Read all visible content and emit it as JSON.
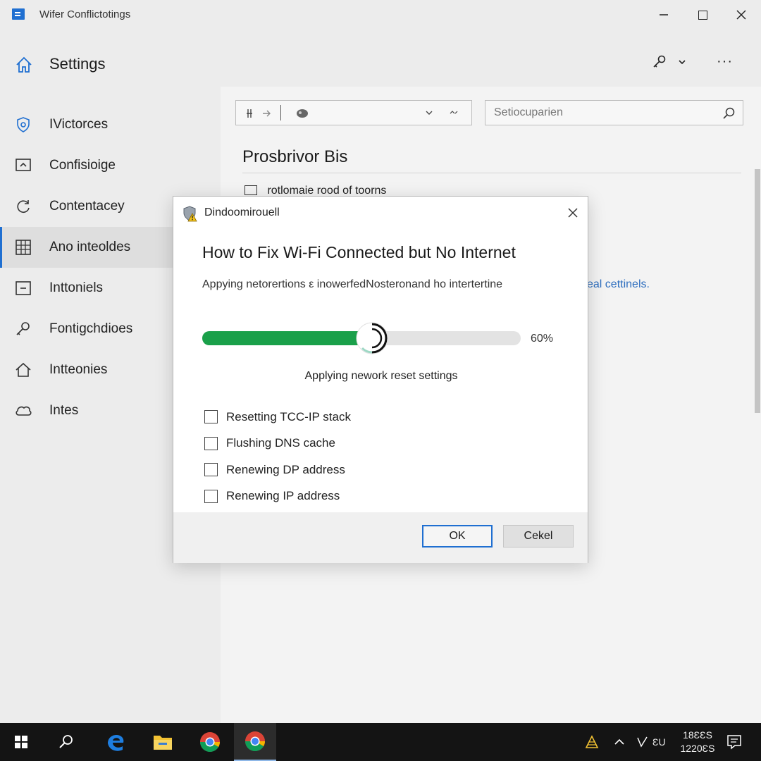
{
  "window": {
    "title": "Wifer Conflictotings",
    "controls": {
      "minimize": "—",
      "maximize": "",
      "close": "✕"
    }
  },
  "header": {
    "title": "Settings",
    "tools": {
      "help_icon": "key-icon",
      "dropdown_icon": "chevron-down-icon",
      "more_label": "···"
    }
  },
  "sidebar": {
    "items": [
      {
        "label": "IVictorces",
        "icon": "shield-gear-icon",
        "active": false
      },
      {
        "label": "Confisioige",
        "icon": "monitor-icon",
        "active": false
      },
      {
        "label": "Contentacey",
        "icon": "refresh-icon",
        "active": false
      },
      {
        "label": "Ano inteoldes",
        "icon": "grid-icon",
        "active": true
      },
      {
        "label": "Inttoniels",
        "icon": "window-icon",
        "active": false
      },
      {
        "label": "Fontigchdioes",
        "icon": "key-icon",
        "active": false
      },
      {
        "label": "Intteonies",
        "icon": "home-icon",
        "active": false
      },
      {
        "label": "Intes",
        "icon": "cloud-icon",
        "active": false
      }
    ]
  },
  "content": {
    "search": {
      "placeholder": "Setiocuparien"
    },
    "section_title": "Prosbrivor Bis",
    "row_text": "rotlomaie rood of toorns",
    "link_text": "eal cettinels."
  },
  "dialog": {
    "caption": "Dindoomirouell",
    "heading": "How to Fix Wi-Fi Connected but No Internet",
    "description": "Appying netorertions ε inowerfedNosteronand ho intertertine",
    "progress": {
      "value": 0.6,
      "label": "60%"
    },
    "status": "Applying nework reset settings",
    "steps": [
      {
        "label": "Resetting TCC-IP stack",
        "checked": false
      },
      {
        "label": "Flushing DNS cache",
        "checked": false
      },
      {
        "label": "Renewing DP address",
        "checked": false
      },
      {
        "label": "Renewing IP address",
        "checked": false
      }
    ],
    "buttons": {
      "ok": "OK",
      "cancel": "Cekel"
    }
  },
  "taskbar": {
    "apps": [
      {
        "name": "start",
        "icon": "windows-logo-icon",
        "active": false
      },
      {
        "name": "search",
        "icon": "search-icon",
        "active": false
      },
      {
        "name": "edge",
        "icon": "edge-icon",
        "active": false
      },
      {
        "name": "explorer",
        "icon": "folder-icon",
        "active": false
      },
      {
        "name": "chrome",
        "icon": "chrome-icon",
        "active": false
      },
      {
        "name": "chrome-2",
        "icon": "chrome-icon",
        "active": true
      }
    ],
    "tray": {
      "language": "ƐU",
      "time": "18ƐƐS",
      "date": "1220ƐS"
    }
  },
  "colors": {
    "accent": "#1f6fd1",
    "progress": "#1aa04a",
    "taskbar": "#141414",
    "link": "#2f6fbf"
  }
}
